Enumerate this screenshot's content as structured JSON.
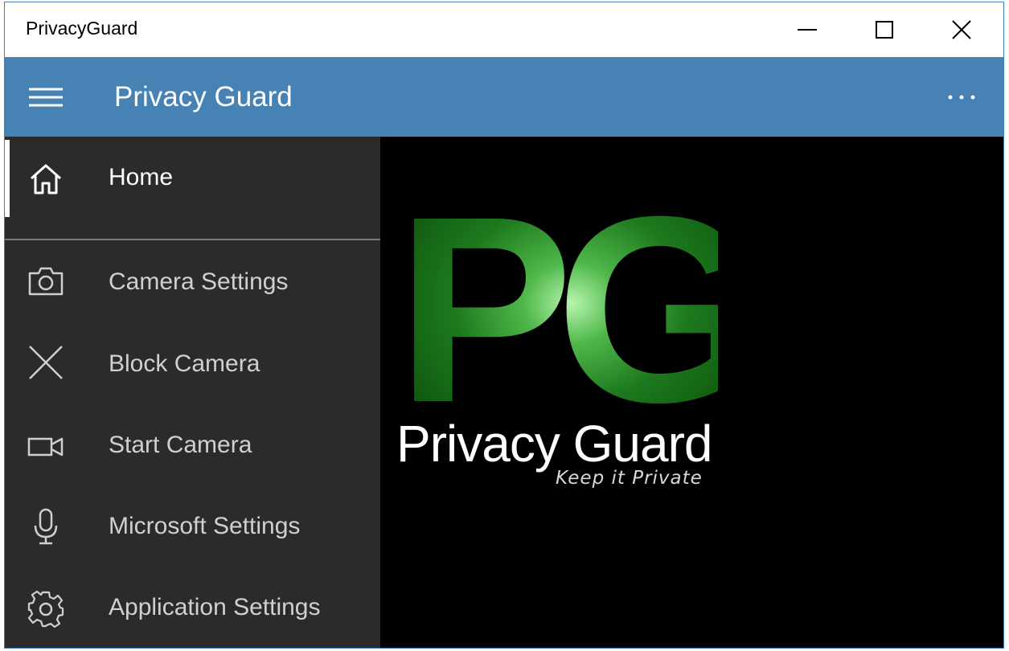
{
  "window": {
    "title": "PrivacyGuard"
  },
  "appbar": {
    "title": "Privacy Guard",
    "menu_icon": "hamburger-icon",
    "more_icon": "more-ellipsis-icon"
  },
  "sidebar": {
    "items": [
      {
        "label": "Home",
        "icon": "home-icon",
        "selected": true
      },
      {
        "label": "Camera Settings",
        "icon": "camera-icon"
      },
      {
        "label": "Block Camera",
        "icon": "close-x-icon"
      },
      {
        "label": "Start Camera",
        "icon": "video-camera-icon"
      },
      {
        "label": "Microsoft Settings",
        "icon": "microphone-icon"
      },
      {
        "label": "Application Settings",
        "icon": "gear-icon"
      }
    ]
  },
  "content": {
    "logo_letters": "PG",
    "logo_name": "Privacy Guard",
    "logo_tagline": "Keep it Private"
  },
  "colors": {
    "accent": "#4682b4",
    "sidebar_bg": "#2b2b2b",
    "content_bg": "#000000",
    "logo_green": "#1e7a1e"
  }
}
